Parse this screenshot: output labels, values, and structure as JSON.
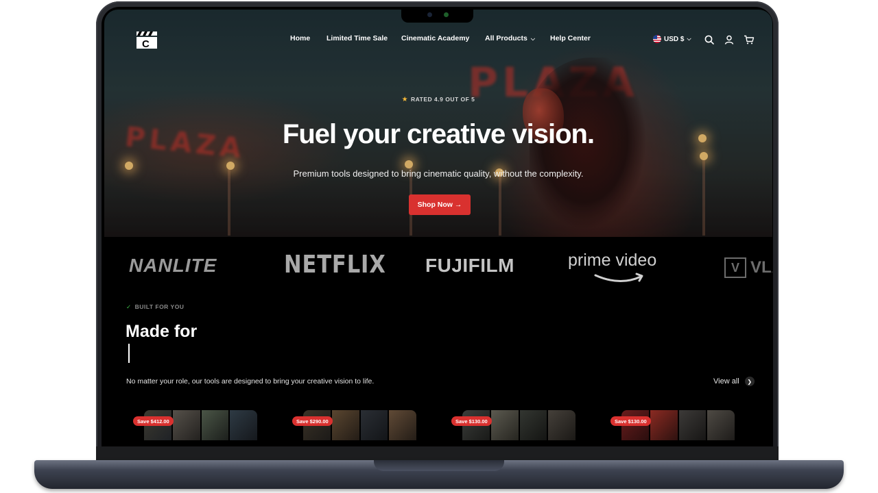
{
  "nav": {
    "links": [
      {
        "label": "Home"
      },
      {
        "label": "Limited Time Sale"
      },
      {
        "label": "Cinematic Academy"
      },
      {
        "label": "All Products",
        "has_dropdown": true
      },
      {
        "label": "Help Center"
      }
    ],
    "currency": "USD $",
    "icons": [
      "flag-us-icon",
      "search-icon",
      "account-icon",
      "cart-icon"
    ]
  },
  "hero": {
    "rating": "RATED 4.9 OUT OF 5",
    "headline": "Fuel your creative vision.",
    "subhead": "Premium tools designed to bring cinematic quality, without the complexity.",
    "cta": "Shop Now →"
  },
  "brands": [
    "NANLITE",
    "NETFLIX",
    "FUJIFILM",
    "prime video",
    "VLA"
  ],
  "section": {
    "eyebrow": "BUILT FOR YOU",
    "title": "Made for",
    "description": "No matter your role, our tools are designed to bring your creative vision to life.",
    "view_all": "View all"
  },
  "cards": [
    {
      "badge": "Save $412.00"
    },
    {
      "badge": "Save $290.00"
    },
    {
      "badge": "Save $130.00"
    },
    {
      "badge": "Save $130.00"
    }
  ],
  "colors": {
    "accent_red": "#d9312f",
    "star": "#f5b93a",
    "check_green": "#3fbf4a"
  }
}
